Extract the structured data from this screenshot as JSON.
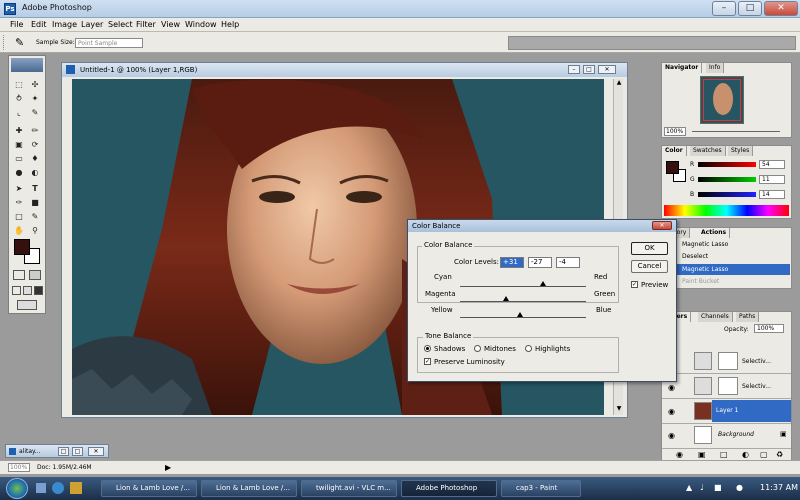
{
  "app": {
    "title": "Adobe Photoshop"
  },
  "menu": [
    "File",
    "Edit",
    "Image",
    "Layer",
    "Select",
    "Filter",
    "View",
    "Window",
    "Help"
  ],
  "options": {
    "sample_size_label": "Sample Size:",
    "sample_size_value": "Point Sample"
  },
  "document": {
    "title": "Untitled-1 @ 100% (Layer 1,RGB)"
  },
  "navigator": {
    "tabs": [
      "Navigator",
      "Info"
    ],
    "zoom": "100%"
  },
  "color_panel": {
    "tabs": [
      "Color",
      "Swatches",
      "Styles"
    ],
    "channels": [
      {
        "label": "R",
        "value": "54"
      },
      {
        "label": "G",
        "value": "11"
      },
      {
        "label": "B",
        "value": "14"
      }
    ]
  },
  "history_panel": {
    "tabs": [
      "History",
      "Actions"
    ],
    "items": [
      "Magnetic Lasso",
      "Deselect",
      "Magnetic Lasso",
      "Paint Bucket"
    ]
  },
  "layers_panel": {
    "tabs": [
      "Layers",
      "Channels",
      "Paths"
    ],
    "opacity_label": "Opacity:",
    "opacity_value": "100%",
    "layers": [
      "Selectiv...",
      "Selectiv...",
      "Layer 1",
      "Background"
    ]
  },
  "dialog": {
    "title": "Color Balance",
    "group_label": "Color Balance",
    "levels_label": "Color Levels:",
    "levels": [
      "+31",
      "-27",
      "-4"
    ],
    "sliders": [
      {
        "left": "Cyan",
        "right": "Red",
        "value": 31
      },
      {
        "left": "Magenta",
        "right": "Green",
        "value": -27
      },
      {
        "left": "Yellow",
        "right": "Blue",
        "value": -4
      }
    ],
    "tone_label": "Tone Balance",
    "tones": [
      "Shadows",
      "Midtones",
      "Highlights"
    ],
    "selected_tone": "Shadows",
    "preserve_label": "Preserve Luminosity",
    "preserve_checked": true,
    "ok": "OK",
    "cancel": "Cancel",
    "preview": "Preview",
    "preview_checked": true
  },
  "minimized_doc": {
    "label": "alitay..."
  },
  "status": {
    "zoom": "100%",
    "doc": "Doc: 1.95M/2.46M"
  },
  "taskbar": {
    "items": [
      "Lion & Lamb Love /...",
      "Lion & Lamb Love /...",
      "twilight.avi - VLC m...",
      "Adobe Photoshop",
      "cap3 - Paint"
    ],
    "active_index": 3,
    "time": "11:37 AM"
  },
  "colors": {
    "accent": "#316ac5",
    "foreground_color": "#36100e",
    "photo_background": "#255661"
  }
}
